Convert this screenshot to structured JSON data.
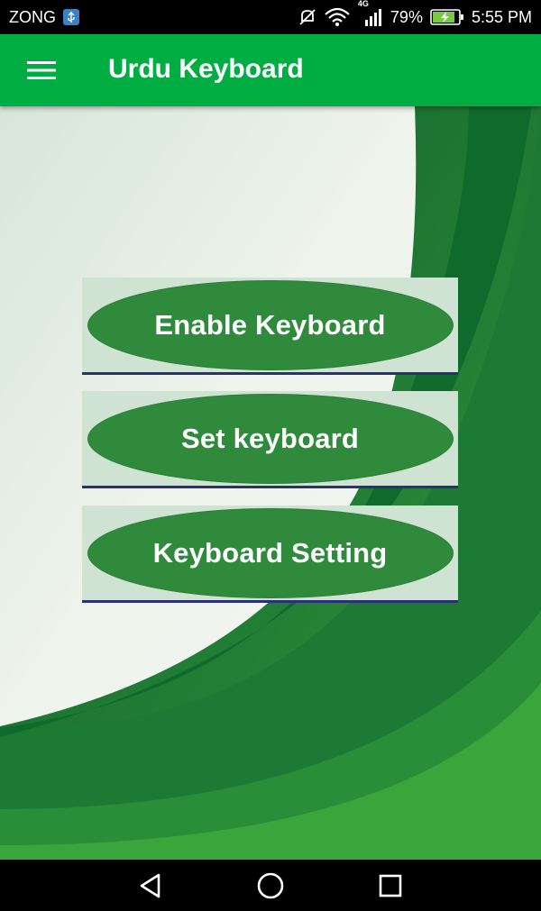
{
  "status_bar": {
    "carrier": "ZONG",
    "network_type": "4G",
    "battery": "79%",
    "time": "5:55 PM",
    "icons": [
      "usb-icon",
      "mute-icon",
      "wifi-icon",
      "signal-icon",
      "battery-charging-icon"
    ]
  },
  "app_bar": {
    "title": "Urdu Keyboard",
    "menu_icon": "hamburger-menu-icon"
  },
  "buttons": [
    {
      "label": "Enable Keyboard"
    },
    {
      "label": "Set keyboard"
    },
    {
      "label": "Keyboard Setting"
    }
  ],
  "nav_bar": {
    "icons": [
      "back-icon",
      "home-icon",
      "recents-icon"
    ]
  },
  "colors": {
    "app_bar": "#00ad43",
    "button_oval": "#2f8a3c",
    "button_card": "#cfe3d3",
    "background_dark_green": "#0d6b2f",
    "background_light": "#eef3ec"
  }
}
